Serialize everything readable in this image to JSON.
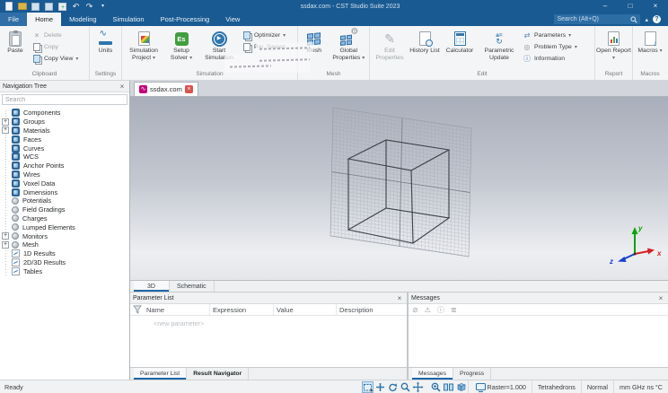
{
  "glyphs": {
    "caret": "▾",
    "close": "×",
    "minimize": "–",
    "maximize": "□",
    "undo": "↶",
    "redo": "↷",
    "search_caret": "▴",
    "help": "?",
    "delete": "×",
    "params": "⇄",
    "problem_type": "◎",
    "info": "ⓘ",
    "pencil": "✎",
    "gear": "⚙",
    "down_arrow": "↓",
    "play": "▶",
    "wave": "∿",
    "a_eq": "a=",
    "refresh": "↻",
    "es": "Es",
    "plus_green": "+"
  },
  "window": {
    "title": "ssdax.com - CST Studio Suite 2023"
  },
  "ribbon": {
    "tabs": [
      "File",
      "Home",
      "Modeling",
      "Simulation",
      "Post-Processing",
      "View"
    ],
    "search_placeholder": "Search (Alt+Q)",
    "groups": {
      "clipboard": {
        "label": "Clipboard",
        "paste": "Paste",
        "delete": "Delete",
        "copy": "Copy",
        "copy_view": "Copy View"
      },
      "settings": {
        "label": "Settings",
        "units": "Units"
      },
      "simulation": {
        "label": "Simulation",
        "project": "Simulation Project",
        "solver": "Setup Solver",
        "start": "Start Simulation",
        "optimizer": "Optimizer",
        "par_sweep": "Par. Sweep"
      },
      "mesh": {
        "label": "Mesh",
        "mesh_view": "Mesh",
        "global_props": "Global Properties"
      },
      "edit": {
        "label": "Edit",
        "edit_properties": "Edit Properties",
        "history_list": "History List",
        "calculator": "Calculator",
        "parametric_update": "Parametric Update",
        "parameters": "Parameters",
        "problem_type": "Problem Type",
        "information": "Information"
      },
      "report": {
        "label": "Report",
        "open_report": "Open Report"
      },
      "macros": {
        "label": "Macros",
        "macros": "Macros"
      }
    }
  },
  "nav_tree": {
    "title": "Navigation Tree",
    "search_placeholder": "Search",
    "items": [
      {
        "label": "Components"
      },
      {
        "label": "Groups"
      },
      {
        "label": "Materials"
      },
      {
        "label": "Faces"
      },
      {
        "label": "Curves"
      },
      {
        "label": "WCS"
      },
      {
        "label": "Anchor Points"
      },
      {
        "label": "Wires"
      },
      {
        "label": "Voxel Data"
      },
      {
        "label": "Dimensions"
      },
      {
        "label": "Potentials"
      },
      {
        "label": "Field Gradings"
      },
      {
        "label": "Charges"
      },
      {
        "label": "Lumped Elements"
      },
      {
        "label": "Monitors"
      },
      {
        "label": "Mesh"
      },
      {
        "label": "1D Results"
      },
      {
        "label": "2D/3D Results"
      },
      {
        "label": "Tables"
      }
    ]
  },
  "document": {
    "tab": "ssdax.com"
  },
  "view_tabs": {
    "t3d": "3D",
    "schematic": "Schematic"
  },
  "axes": {
    "x": "x",
    "y": "y",
    "z": "z"
  },
  "parameter_list": {
    "title": "Parameter List",
    "columns": [
      "Name",
      "Expression",
      "Value",
      "Description"
    ],
    "new_row": "<new parameter>",
    "tabs": [
      "Parameter List",
      "Result Navigator"
    ]
  },
  "messages": {
    "title": "Messages",
    "toolbar": [
      {
        "name": "clear-icon",
        "glyph": "⊘"
      },
      {
        "name": "warning-icon",
        "glyph": "⚠"
      },
      {
        "name": "info-icon",
        "glyph": "ⓘ"
      },
      {
        "name": "filter-list-icon",
        "glyph": "≣"
      }
    ],
    "tabs": [
      "Messages",
      "Progress"
    ]
  },
  "status_bar": {
    "ready": "Ready",
    "raster": "Raster=1.000",
    "mesh_type": "Tetrahedrons",
    "mode": "Normal",
    "units": "mm GHz ns °C"
  }
}
